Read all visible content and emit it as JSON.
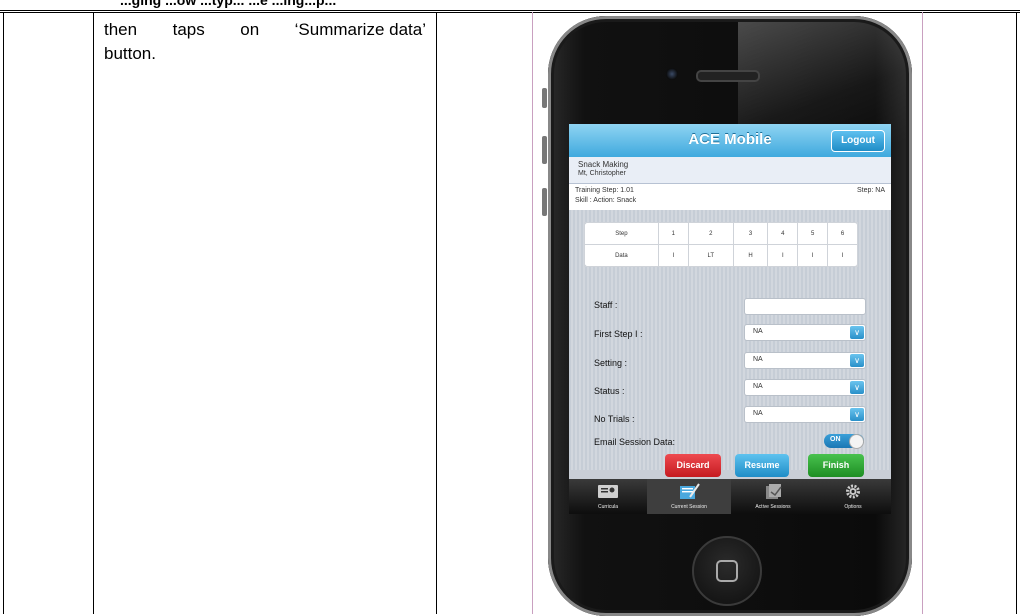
{
  "document": {
    "top_text": "...ging ...ow ...typ... ...e ...ing...p...",
    "step_text_line1_a": "then",
    "step_text_line1_b": "taps",
    "step_text_line1_c": "on",
    "step_text_line1_d": "‘Summarize data’",
    "step_text_line2": "button."
  },
  "app": {
    "title": "ACE Mobile",
    "logout_label": "Logout",
    "program": "Snack Making",
    "learner": "Mt, Christopher",
    "training_step": "Training Step: 1.01",
    "step_na": "Step: NA",
    "skill": "Skill : Action: Snack",
    "table": {
      "header": [
        "Step",
        "1",
        "2",
        "3",
        "4",
        "5",
        "6"
      ],
      "row": [
        "Data",
        "I",
        "LT",
        "H",
        "I",
        "I",
        "I"
      ]
    },
    "fields": {
      "staff_label": "Staff :",
      "staff_value": "",
      "first_step_label": "First Step I :",
      "first_step_value": "NA",
      "setting_label": "Setting :",
      "setting_value": "NA",
      "status_label": "Status :",
      "status_value": "NA",
      "trials_label": "No Trials :",
      "trials_value": "NA",
      "email_label": "Email Session Data:",
      "email_toggle": "ON"
    },
    "buttons": {
      "discard": "Discard",
      "resume": "Resume",
      "finish": "Finish"
    },
    "tabs": [
      "Curricula",
      "Current Session",
      "Active Sessions",
      "Options"
    ],
    "active_tab": "Current Session",
    "colors": {
      "navbar": "#3fa9de",
      "discard": "#d9232a",
      "resume": "#2a9bd8",
      "finish": "#25a632"
    }
  }
}
